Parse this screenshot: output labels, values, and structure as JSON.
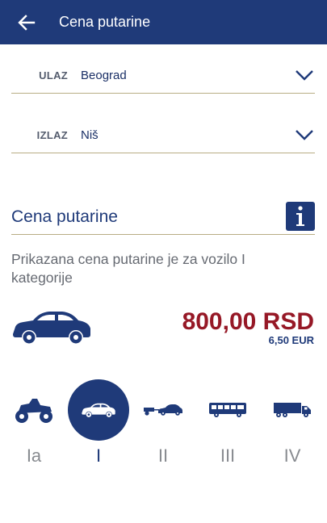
{
  "appbar": {
    "title": "Cena putarine",
    "back_icon": "arrow-left-icon"
  },
  "route": {
    "entry": {
      "label": "ULAZ",
      "value": "Beograd"
    },
    "exit": {
      "label": "IZLAZ",
      "value": "Niš"
    }
  },
  "toll": {
    "title": "Cena putarine",
    "description": "Prikazana cena putarine je za vozilo I kategorije",
    "price_rsd": "800,00 RSD",
    "price_eur": "6,50 EUR"
  },
  "categories": [
    {
      "label": "Ia",
      "icon": "quad-bike-icon"
    },
    {
      "label": "I",
      "icon": "car-icon",
      "selected": true
    },
    {
      "label": "II",
      "icon": "car-with-trailer-icon"
    },
    {
      "label": "III",
      "icon": "bus-icon"
    },
    {
      "label": "IV",
      "icon": "truck-icon"
    }
  ],
  "colors": {
    "primary": "#1f3a79",
    "price": "#961826",
    "divider": "#b8ad84",
    "muted": "#888b90"
  }
}
